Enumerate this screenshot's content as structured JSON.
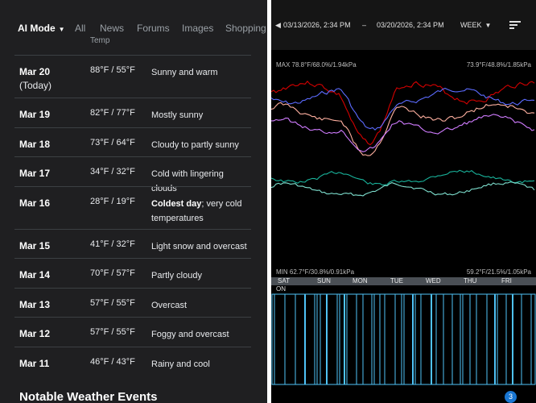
{
  "left": {
    "mode": "AI Mode",
    "tabs": [
      "All",
      "News",
      "Forums",
      "Images",
      "Shopping"
    ],
    "column_header": "Temp",
    "rows": [
      {
        "date": "Mar 20",
        "sub": "(Today)",
        "temp": "88°F / 55°F",
        "cond": "Sunny and warm"
      },
      {
        "date": "Mar 19",
        "temp": "82°F / 77°F",
        "cond": "Mostly sunny"
      },
      {
        "date": "Mar 18",
        "temp": "73°F / 64°F",
        "cond": "Cloudy to partly sunny"
      },
      {
        "date": "Mar 17",
        "temp": "34°F / 32°F",
        "cond": "Cold with lingering clouds"
      },
      {
        "date": "Mar 16",
        "temp": "28°F / 19°F",
        "cond_bold": "Coldest day",
        "cond": "; very cold temperatures"
      },
      {
        "date": "Mar 15",
        "temp": "41°F / 32°F",
        "cond": "Light snow and overcast"
      },
      {
        "date": "Mar 14",
        "temp": "70°F / 57°F",
        "cond": "Partly cloudy"
      },
      {
        "date": "Mar 13",
        "temp": "57°F / 55°F",
        "cond": "Overcast"
      },
      {
        "date": "Mar 12",
        "temp": "57°F / 55°F",
        "cond": "Foggy and overcast"
      },
      {
        "date": "Mar 11",
        "temp": "46°F / 43°F",
        "cond": "Rainy and cool"
      }
    ],
    "section_heading": "Notable Weather Events"
  },
  "right": {
    "range_start": "03/13/2026, 2:34 PM",
    "range_sep": "–",
    "range_end": "03/20/2026, 2:34 PM",
    "period": "WEEK",
    "max_left": "MAX 78.8°F/68.0%/1.94kPa",
    "max_right": "73.9°F/48.8%/1.85kPa",
    "min_left": "MIN 62.7°F/30.8%/0.91kPa",
    "min_right": "59.2°F/21.5%/1.05kPa",
    "days": [
      "SAT",
      "SUN",
      "MON",
      "TUE",
      "WED",
      "THU",
      "FRI"
    ],
    "on_label": "ON",
    "badge": "3",
    "colors": {
      "red": "#d50000",
      "blue": "#5c6bff",
      "violet": "#d07cff",
      "peach": "#ffb0a0",
      "teal": "#19b39b",
      "teal2": "#7ee0cf",
      "bars": "#4fc3f7"
    }
  }
}
